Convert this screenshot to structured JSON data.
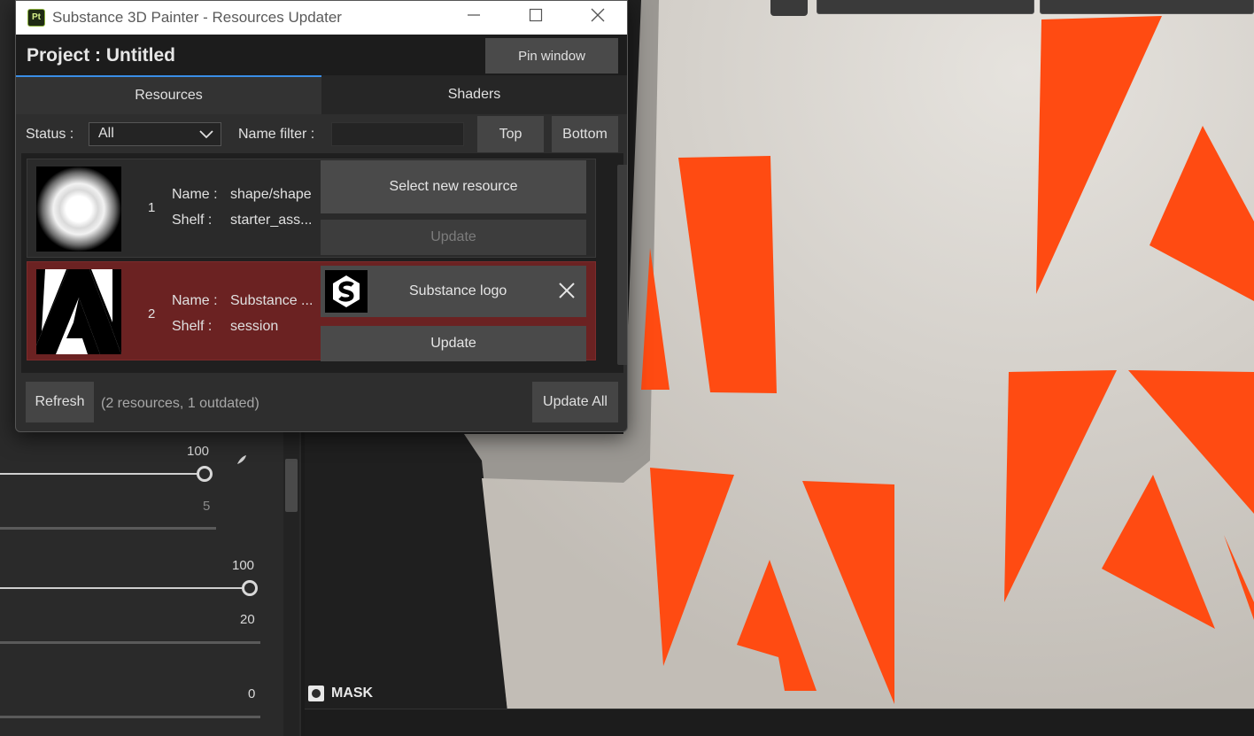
{
  "window": {
    "title": "Substance 3D Painter - Resources Updater",
    "app_badge": "Pt",
    "minimize": "—",
    "maximize": "☐",
    "close": "✕"
  },
  "header": {
    "project_title": "Project : Untitled",
    "pin_label": "Pin window"
  },
  "tabs": [
    {
      "label": "Resources",
      "active": true
    },
    {
      "label": "Shaders",
      "active": false
    }
  ],
  "filters": {
    "status_label": "Status :",
    "status_value": "All",
    "name_filter_label": "Name filter :",
    "name_filter_value": "",
    "top_label": "Top",
    "bottom_label": "Bottom"
  },
  "resources": [
    {
      "index": "1",
      "name_label": "Name :",
      "name": "shape/shape",
      "shelf_label": "Shelf :",
      "shelf": "starter_ass...",
      "action_label": "Select new resource",
      "update_label": "Update",
      "update_enabled": false,
      "outdated": false
    },
    {
      "index": "2",
      "name_label": "Name :",
      "name": "Substance ...",
      "shelf_label": "Shelf :",
      "shelf": "session",
      "selected_resource": "Substance logo",
      "update_label": "Update",
      "update_enabled": true,
      "outdated": true
    }
  ],
  "footer": {
    "refresh_label": "Refresh",
    "summary": "(2 resources, 1 outdated)",
    "update_all_label": "Update All"
  },
  "background_panel": {
    "values": [
      "100",
      "5",
      "100",
      "20",
      "0"
    ],
    "mask_label": "MASK"
  },
  "colors": {
    "accent": "#3a8ee6",
    "outdated_row": "#6b2222",
    "logo_orange": "#ff4b12"
  }
}
